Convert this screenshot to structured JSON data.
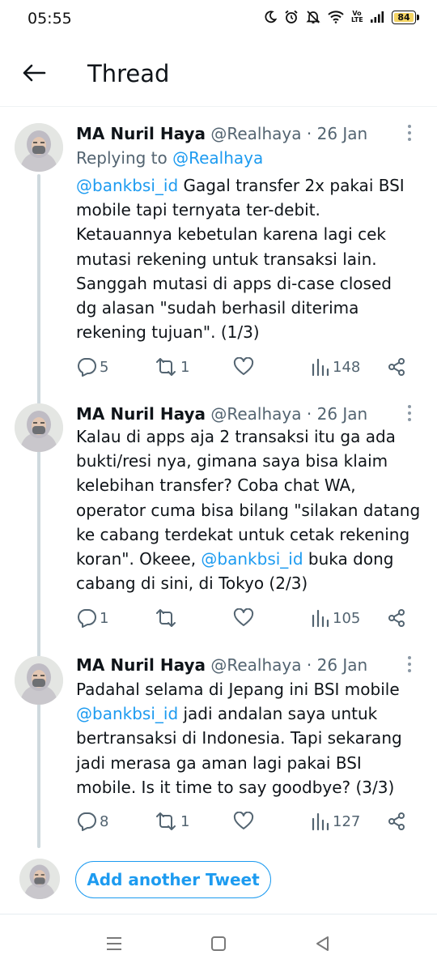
{
  "status_bar": {
    "time": "05:55",
    "battery_text": "84",
    "battery_level": 0.84,
    "network_label": "Vo LTE",
    "icons": [
      "moon-icon",
      "alarm-icon",
      "mute-icon",
      "wifi-icon",
      "volte-icon",
      "signal-icon",
      "battery-icon"
    ]
  },
  "header": {
    "title": "Thread",
    "back_icon": "arrow-left-icon"
  },
  "colors": {
    "accent": "#1d9bf0",
    "text": "#0f1419",
    "muted": "#536471",
    "thread_line": "#cfd9de"
  },
  "tweets": [
    {
      "name": "MA Nuril Haya",
      "handle": "@Realhaya",
      "separator": " · ",
      "date": "26 Jan",
      "reply_prefix": "Replying to ",
      "reply_to": "@Realhaya",
      "lines": [
        [
          {
            "t": "@bankbsi_id",
            "m": true
          },
          {
            "t": " Gagal transfer 2x pakai BSI",
            "m": false
          }
        ],
        [
          {
            "t": "mobile tapi ternyata ter-debit.",
            "m": false
          }
        ],
        [
          {
            "t": "Ketauannya kebetulan karena lagi cek",
            "m": false
          }
        ],
        [
          {
            "t": "mutasi rekening untuk transaksi lain.",
            "m": false
          }
        ],
        [
          {
            "t": "Sanggah mutasi di apps di-case closed",
            "m": false
          }
        ],
        [
          {
            "t": "dg alasan \"sudah berhasil diterima",
            "m": false
          }
        ],
        [
          {
            "t": "rekening tujuan\". (1/3)",
            "m": false
          }
        ]
      ],
      "replies": "5",
      "retweets": "1",
      "views": "148"
    },
    {
      "name": "MA Nuril Haya",
      "handle": "@Realhaya",
      "separator": " · ",
      "date": "26 Jan",
      "lines": [
        [
          {
            "t": "Kalau di apps aja 2 transaksi itu ga ada",
            "m": false
          }
        ],
        [
          {
            "t": "bukti/resi nya, gimana saya bisa klaim",
            "m": false
          }
        ],
        [
          {
            "t": "kelebihan transfer? Coba chat WA,",
            "m": false
          }
        ],
        [
          {
            "t": "operator cuma bisa bilang \"silakan datang",
            "m": false
          }
        ],
        [
          {
            "t": "ke cabang terdekat untuk cetak rekening",
            "m": false
          }
        ],
        [
          {
            "t": "koran\". Okeee, ",
            "m": false
          },
          {
            "t": "@bankbsi_id",
            "m": true
          },
          {
            "t": " buka dong",
            "m": false
          }
        ],
        [
          {
            "t": "cabang di sini, di Tokyo (2/3)",
            "m": false
          }
        ]
      ],
      "replies": "1",
      "retweets": "",
      "views": "105"
    },
    {
      "name": "MA Nuril Haya",
      "handle": "@Realhaya",
      "separator": " · ",
      "date": "26 Jan",
      "lines": [
        [
          {
            "t": "Padahal selama di Jepang ini BSI mobile",
            "m": false
          }
        ],
        [
          {
            "t": "@bankbsi_id",
            "m": true
          },
          {
            "t": " jadi andalan saya untuk",
            "m": false
          }
        ],
        [
          {
            "t": "bertransaksi di Indonesia. Tapi sekarang",
            "m": false
          }
        ],
        [
          {
            "t": "jadi merasa ga aman lagi pakai BSI",
            "m": false
          }
        ],
        [
          {
            "t": "mobile. Is it time to say goodbye? (3/3)",
            "m": false
          }
        ]
      ],
      "replies": "8",
      "retweets": "1",
      "views": "127"
    }
  ],
  "compose": {
    "button_label": "Add another Tweet"
  },
  "nav_bar": {
    "items": [
      "menu-icon",
      "home-square-icon",
      "back-triangle-icon"
    ]
  }
}
